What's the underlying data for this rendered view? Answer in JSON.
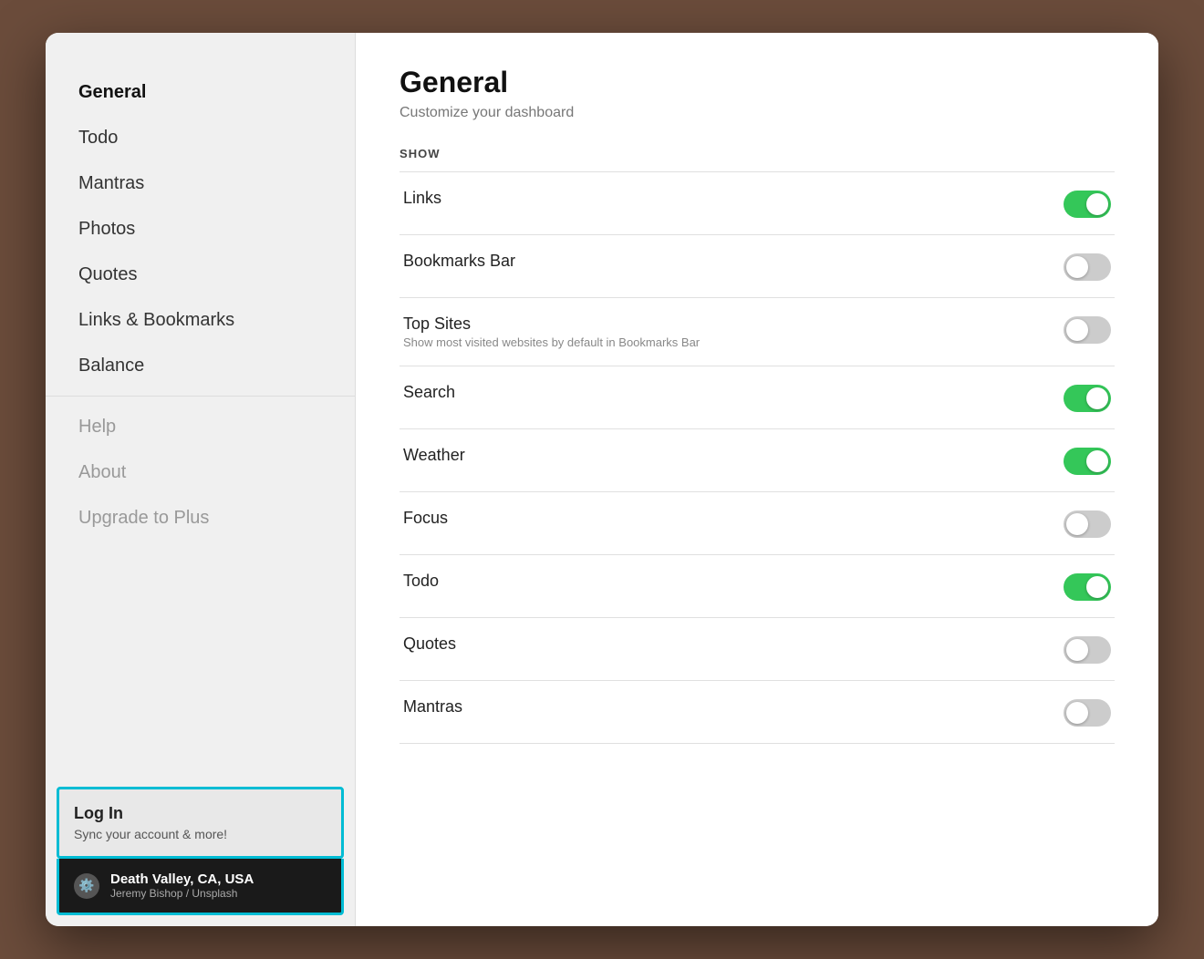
{
  "sidebar": {
    "nav_items": [
      {
        "id": "general",
        "label": "General",
        "active": true,
        "dimmed": false
      },
      {
        "id": "todo",
        "label": "Todo",
        "active": false,
        "dimmed": false
      },
      {
        "id": "mantras",
        "label": "Mantras",
        "active": false,
        "dimmed": false
      },
      {
        "id": "photos",
        "label": "Photos",
        "active": false,
        "dimmed": false
      },
      {
        "id": "quotes",
        "label": "Quotes",
        "active": false,
        "dimmed": false
      },
      {
        "id": "links-bookmarks",
        "label": "Links & Bookmarks",
        "active": false,
        "dimmed": false
      },
      {
        "id": "balance",
        "label": "Balance",
        "active": false,
        "dimmed": false
      }
    ],
    "secondary_items": [
      {
        "id": "help",
        "label": "Help",
        "dimmed": true
      },
      {
        "id": "about",
        "label": "About",
        "dimmed": true
      },
      {
        "id": "upgrade",
        "label": "Upgrade to Plus",
        "dimmed": true
      }
    ],
    "login_card": {
      "title": "Log In",
      "subtitle": "Sync your account & more!"
    },
    "location": {
      "title": "Death Valley, CA, USA",
      "credit": "Jeremy Bishop / Unsplash"
    }
  },
  "main": {
    "title": "General",
    "subtitle": "Customize your dashboard",
    "section_label": "SHOW",
    "toggles": [
      {
        "id": "links",
        "label": "Links",
        "description": "",
        "enabled": true
      },
      {
        "id": "bookmarks-bar",
        "label": "Bookmarks Bar",
        "description": "",
        "enabled": false
      },
      {
        "id": "top-sites",
        "label": "Top Sites",
        "description": "Show most visited websites by default in Bookmarks Bar",
        "enabled": false
      },
      {
        "id": "search",
        "label": "Search",
        "description": "",
        "enabled": true
      },
      {
        "id": "weather",
        "label": "Weather",
        "description": "",
        "enabled": true
      },
      {
        "id": "focus",
        "label": "Focus",
        "description": "",
        "enabled": false
      },
      {
        "id": "todo",
        "label": "Todo",
        "description": "",
        "enabled": true
      },
      {
        "id": "quotes",
        "label": "Quotes",
        "description": "",
        "enabled": false
      },
      {
        "id": "mantras",
        "label": "Mantras",
        "description": "",
        "enabled": false
      }
    ]
  }
}
